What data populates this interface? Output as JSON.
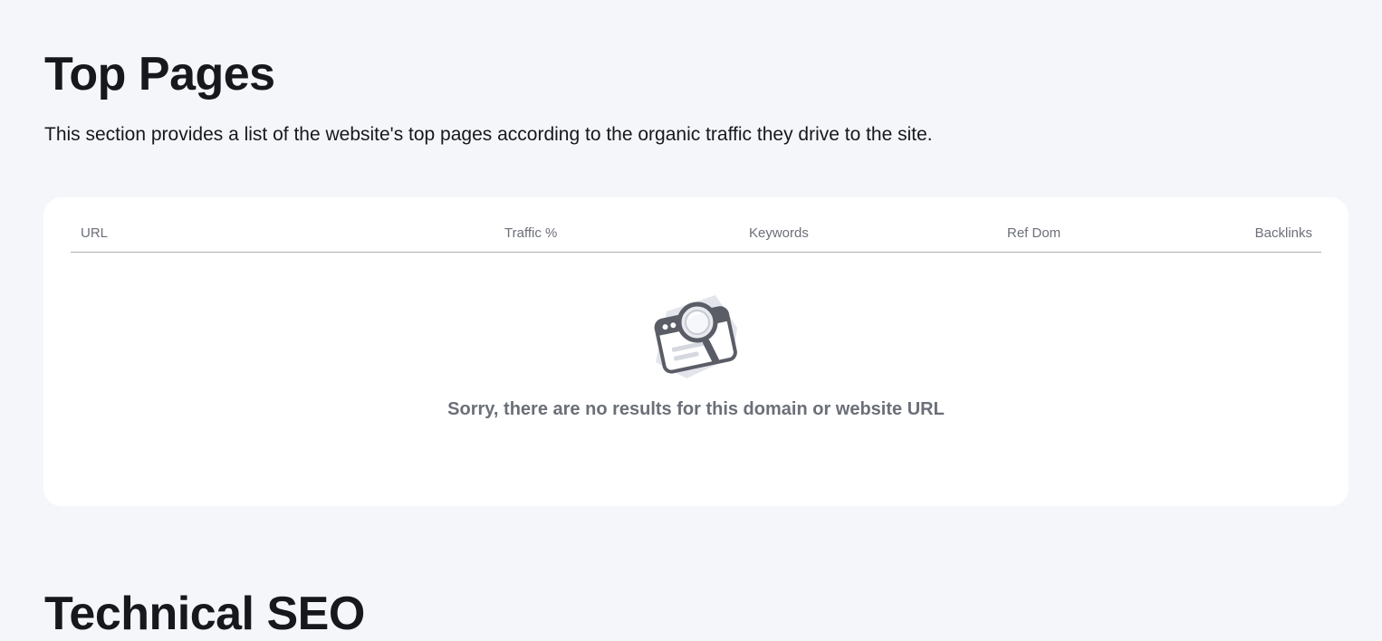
{
  "top_pages": {
    "title": "Top Pages",
    "description": "This section provides a list of the website's top pages according to the organic traffic they drive to the site.",
    "table": {
      "columns": [
        "URL",
        "Traffic %",
        "Keywords",
        "Ref Dom",
        "Backlinks"
      ],
      "rows": []
    },
    "empty_state": {
      "icon": "magnifier-browser-icon",
      "message": "Sorry, there are no results for this domain or website URL"
    }
  },
  "technical_seo": {
    "title": "Technical SEO"
  }
}
